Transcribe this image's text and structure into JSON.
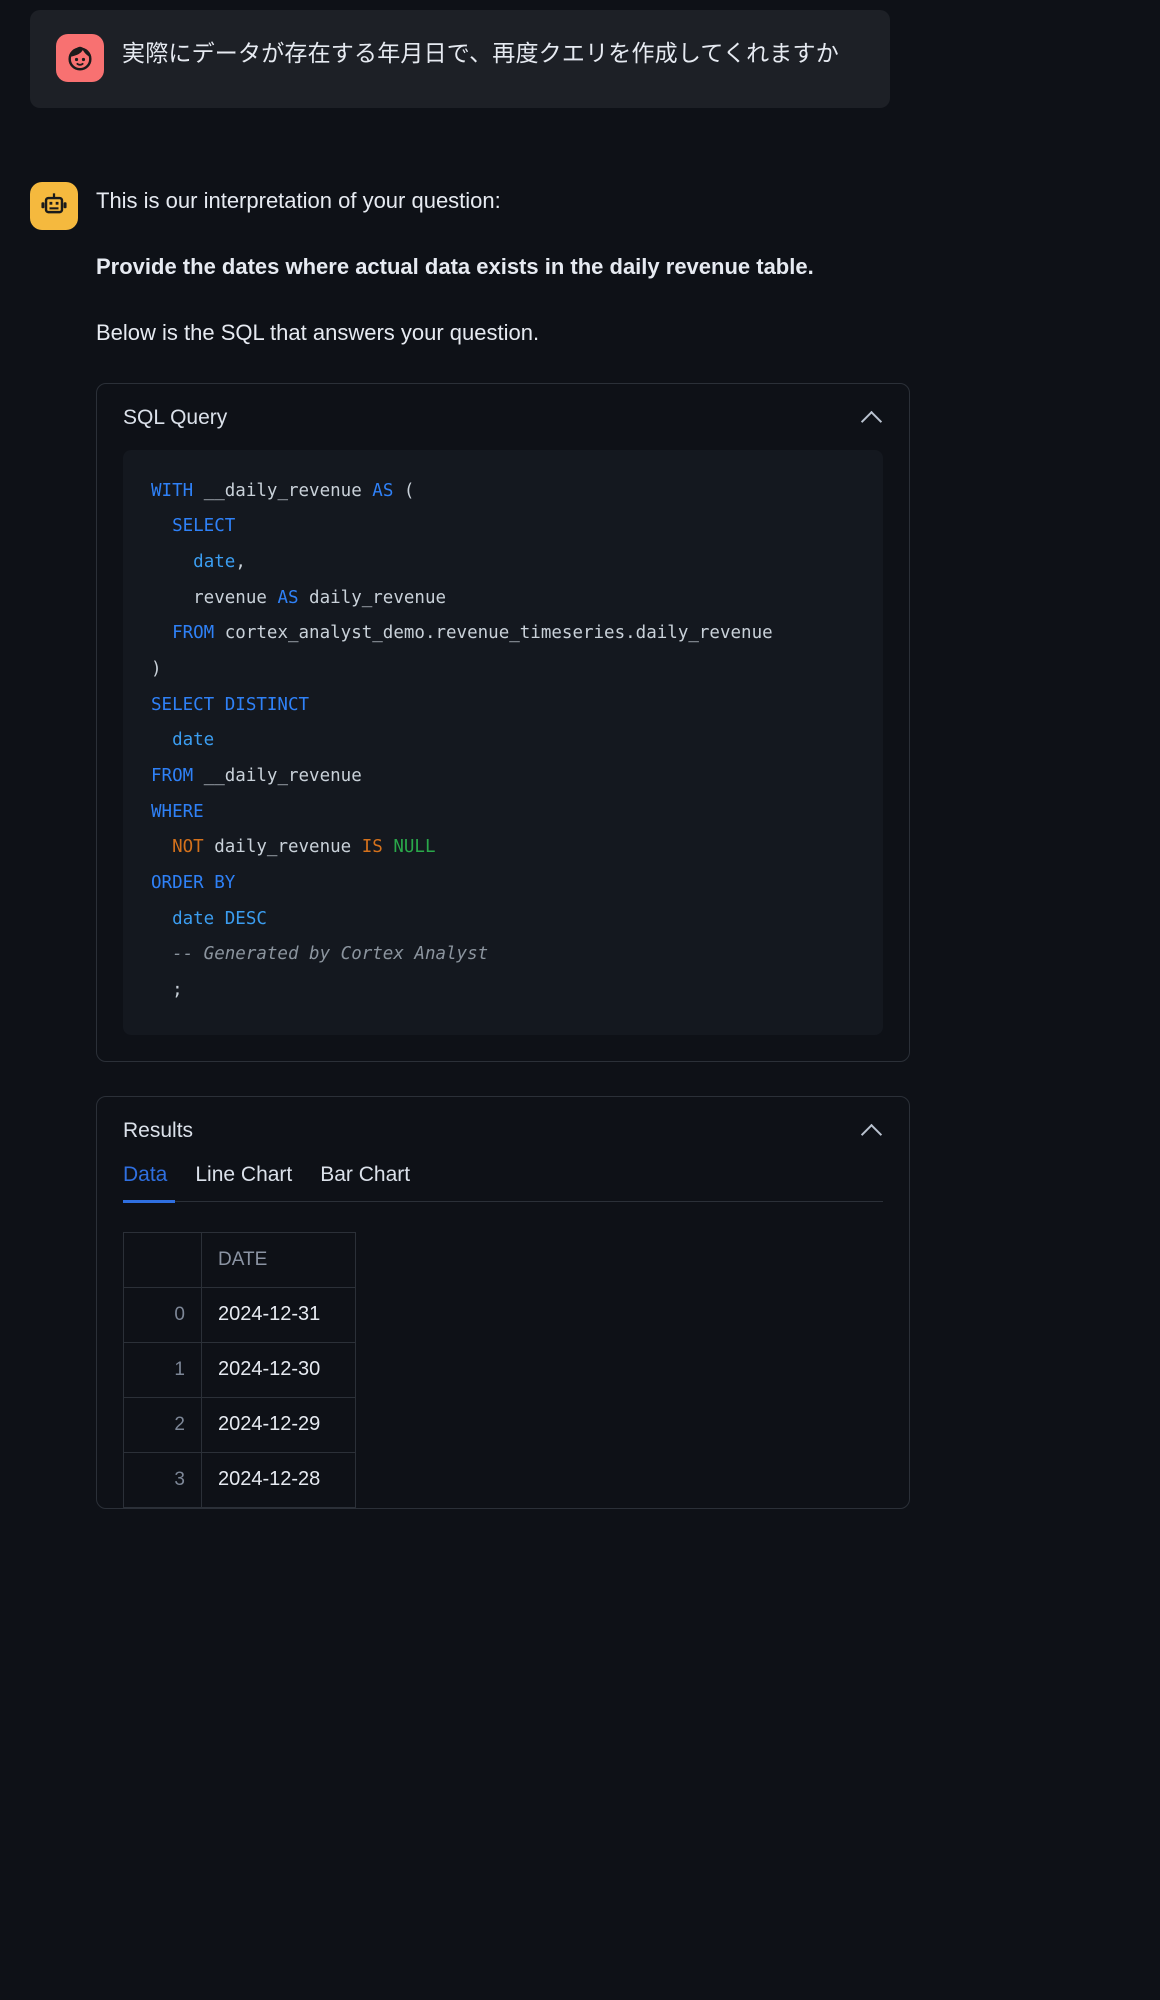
{
  "user_message": {
    "avatar_icon": "user-face-icon",
    "avatar_color": "#f87171",
    "text": "実際にデータが存在する年月日で、再度クエリを作成してくれますか"
  },
  "assistant_message": {
    "avatar_icon": "robot-icon",
    "avatar_color": "#f5b93e",
    "intro": "This is our interpretation of your question:",
    "interpretation": "Provide the dates where actual data exists in the daily revenue table.",
    "below_text": "Below is the SQL that answers your question."
  },
  "sql_card": {
    "title": "SQL Query",
    "collapse_icon": "chevron-up-icon",
    "expanded": true,
    "code_lines": [
      [
        {
          "t": "WITH",
          "c": "kw"
        },
        {
          "t": " __daily_revenue ",
          "c": "id"
        },
        {
          "t": "AS",
          "c": "kw"
        },
        {
          "t": " (",
          "c": "pl"
        }
      ],
      [
        {
          "t": "  ",
          "c": "pl"
        },
        {
          "t": "SELECT",
          "c": "kw"
        }
      ],
      [
        {
          "t": "    ",
          "c": "pl"
        },
        {
          "t": "date",
          "c": "col"
        },
        {
          "t": ",",
          "c": "pl"
        }
      ],
      [
        {
          "t": "    revenue ",
          "c": "id"
        },
        {
          "t": "AS",
          "c": "kw"
        },
        {
          "t": " daily_revenue",
          "c": "id"
        }
      ],
      [
        {
          "t": "  ",
          "c": "pl"
        },
        {
          "t": "FROM",
          "c": "kw"
        },
        {
          "t": " cortex_analyst_demo.revenue_timeseries.daily_revenue",
          "c": "id"
        }
      ],
      [
        {
          "t": ")",
          "c": "pl"
        }
      ],
      [
        {
          "t": "SELECT DISTINCT",
          "c": "kw"
        }
      ],
      [
        {
          "t": "  ",
          "c": "pl"
        },
        {
          "t": "date",
          "c": "col"
        }
      ],
      [
        {
          "t": "FROM",
          "c": "kw"
        },
        {
          "t": " __daily_revenue",
          "c": "id"
        }
      ],
      [
        {
          "t": "WHERE",
          "c": "kw"
        }
      ],
      [
        {
          "t": "  ",
          "c": "pl"
        },
        {
          "t": "NOT",
          "c": "op"
        },
        {
          "t": " daily_revenue ",
          "c": "id"
        },
        {
          "t": "IS",
          "c": "op"
        },
        {
          "t": " ",
          "c": "pl"
        },
        {
          "t": "NULL",
          "c": "null"
        }
      ],
      [
        {
          "t": "ORDER BY",
          "c": "kw"
        }
      ],
      [
        {
          "t": "  ",
          "c": "pl"
        },
        {
          "t": "date DESC",
          "c": "col"
        }
      ],
      [
        {
          "t": "  ",
          "c": "pl"
        },
        {
          "t": "-- Generated by Cortex Analyst",
          "c": "cmt"
        }
      ],
      [
        {
          "t": "  ;",
          "c": "pl"
        }
      ]
    ]
  },
  "results_card": {
    "title": "Results",
    "collapse_icon": "chevron-up-icon",
    "tabs": [
      {
        "label": "Data",
        "active": true
      },
      {
        "label": "Line Chart",
        "active": false
      },
      {
        "label": "Bar Chart",
        "active": false
      }
    ],
    "table": {
      "index_header": "",
      "columns": [
        "DATE"
      ],
      "rows": [
        {
          "index": "0",
          "DATE": "2024-12-31"
        },
        {
          "index": "1",
          "DATE": "2024-12-30"
        },
        {
          "index": "2",
          "DATE": "2024-12-29"
        },
        {
          "index": "3",
          "DATE": "2024-12-28"
        }
      ]
    }
  },
  "theme": {
    "background": "#0e1117",
    "bubble_background": "#1d2026",
    "code_background": "#14181f",
    "border": "#2b3038",
    "accent": "#2f6fe0",
    "text_primary": "#e6eaf1",
    "text_muted": "#8b94a3"
  }
}
